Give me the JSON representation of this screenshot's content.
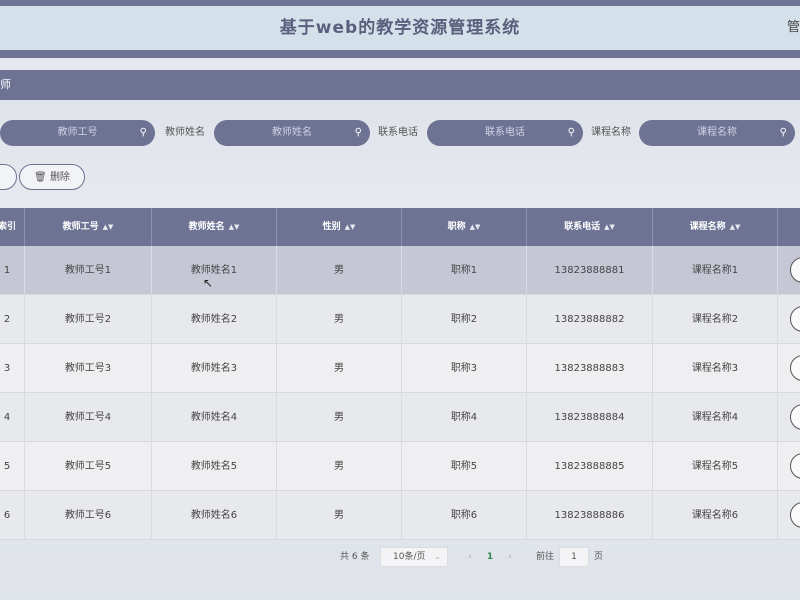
{
  "header": {
    "title": "基于web的教学资源管理系统",
    "right_text": "管"
  },
  "breadcrumb": "师",
  "search": {
    "fields": [
      {
        "label": "",
        "placeholder": "教师工号"
      },
      {
        "label": "教师姓名",
        "placeholder": "教师姓名"
      },
      {
        "label": "联系电话",
        "placeholder": "联系电话"
      },
      {
        "label": "课程名称",
        "placeholder": "课程名称"
      }
    ]
  },
  "actions": {
    "delete_label": "删除"
  },
  "table": {
    "columns": [
      "索引",
      "教师工号",
      "教师姓名",
      "性别",
      "职称",
      "联系电话",
      "课程名称"
    ],
    "rows": [
      [
        "1",
        "教师工号1",
        "教师姓名1",
        "男",
        "职称1",
        "13823888881",
        "课程名称1"
      ],
      [
        "2",
        "教师工号2",
        "教师姓名2",
        "男",
        "职称2",
        "13823888882",
        "课程名称2"
      ],
      [
        "3",
        "教师工号3",
        "教师姓名3",
        "男",
        "职称3",
        "13823888883",
        "课程名称3"
      ],
      [
        "4",
        "教师工号4",
        "教师姓名4",
        "男",
        "职称4",
        "13823888884",
        "课程名称4"
      ],
      [
        "5",
        "教师工号5",
        "教师姓名5",
        "男",
        "职称5",
        "13823888885",
        "课程名称5"
      ],
      [
        "6",
        "教师工号6",
        "教师姓名6",
        "男",
        "职称6",
        "13823888886",
        "课程名称6"
      ]
    ]
  },
  "pagination": {
    "total": "共 6 条",
    "page_size": "10条/页",
    "current_page": "1",
    "goto_label": "前往",
    "goto_value": "1",
    "page_unit": "页"
  },
  "colors": {
    "accent": "#6e7394",
    "header_bg": "#d5e1ea",
    "current_page": "#2e8b57"
  }
}
